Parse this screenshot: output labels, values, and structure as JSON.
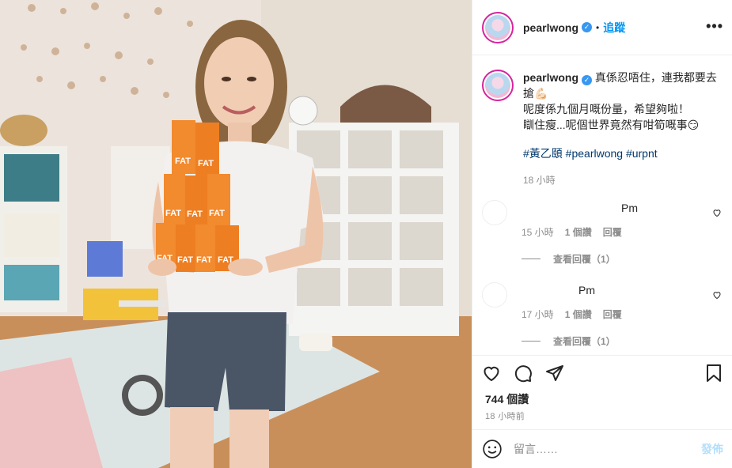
{
  "post": {
    "username": "pearlwong",
    "follow_label": "追蹤",
    "separator": "•",
    "more_label": "•••",
    "verified_mark": "✓"
  },
  "caption": {
    "username": "pearlwong",
    "line1": " 真係忍唔住，連我都要去搶💪🏻",
    "line2": "呢度係九個月嘅份量，希望夠啦！",
    "line3": "瞓住瘦...呢個世界竟然有咁筍嘅事😏",
    "hashtags": "#黃乙頤 #pearlwong #urpnt",
    "time": "18 小時"
  },
  "comments": [
    {
      "name": "Pm",
      "time": "15 小時",
      "likes": "1 個讚",
      "reply": "回覆",
      "view_replies": "查看回覆（1）"
    },
    {
      "name": "Pm",
      "time": "17 小時",
      "likes": "1 個讚",
      "reply": "回覆",
      "view_replies": "查看回覆（1）"
    }
  ],
  "actions": {
    "icons": [
      "heart-icon",
      "comment-icon",
      "share-icon",
      "bookmark-icon"
    ],
    "likes": "744 個讚",
    "time_ago": "18 小時前"
  },
  "add_comment": {
    "placeholder": "留言……",
    "post_label": "發佈",
    "icon": "emoji-icon"
  },
  "photo": {
    "box_label": "FAT"
  },
  "colors": {
    "accent": "#0095f6",
    "verified": "#3897f0",
    "box_orange": "#f28a2e"
  }
}
